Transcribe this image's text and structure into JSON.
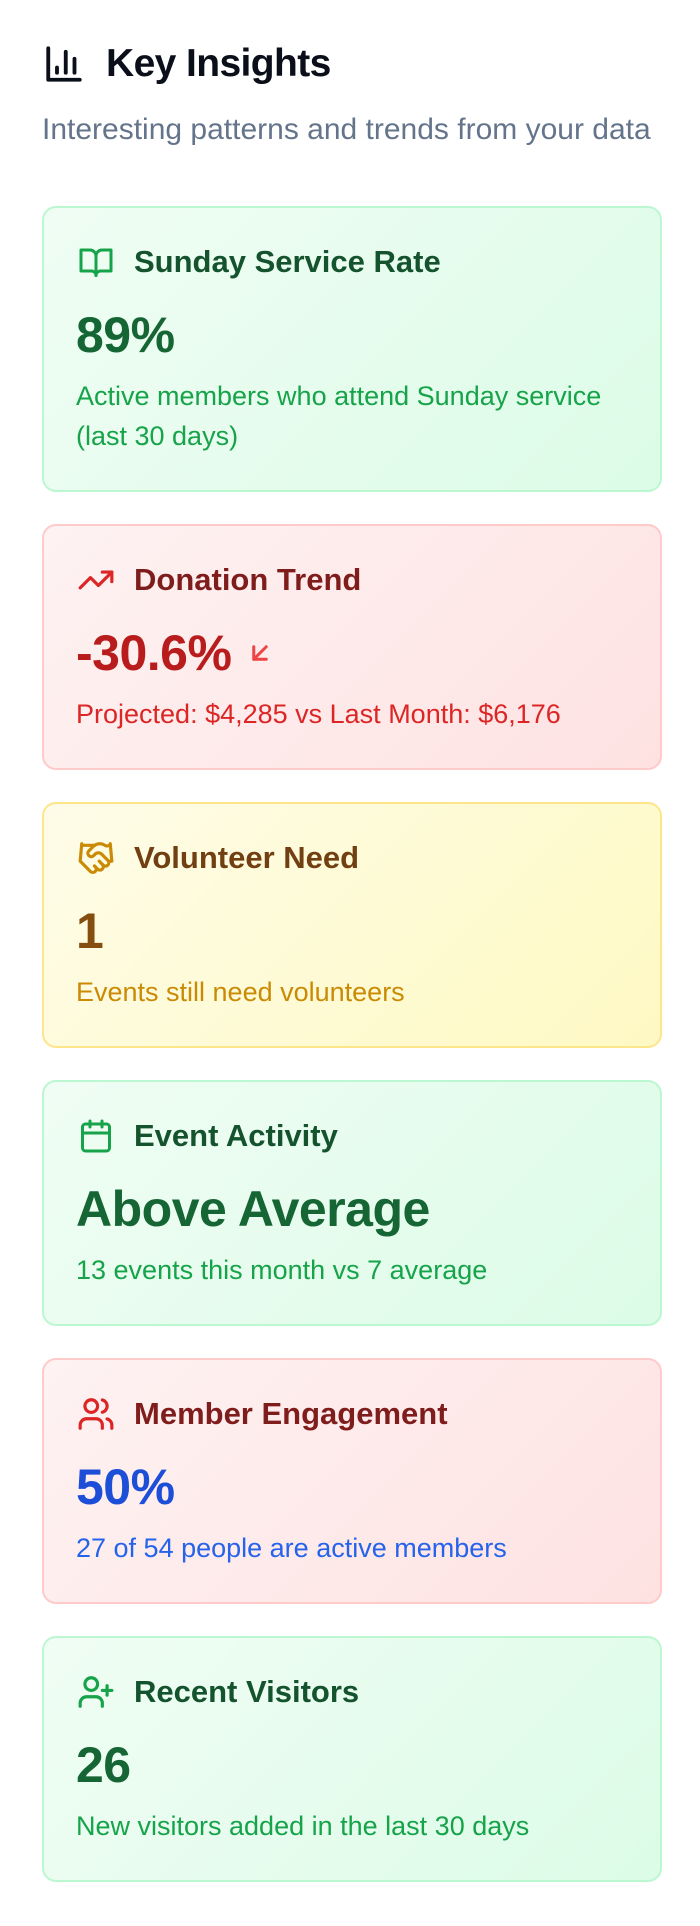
{
  "header": {
    "title": "Key Insights",
    "subtitle": "Interesting patterns and trends from your data",
    "icon": "bar-chart-icon"
  },
  "colors": {
    "green_bg": "#dcfce7",
    "red_bg": "#fee2e2",
    "yellow_bg": "#fef9c3",
    "blue_value": "#1d4ed8"
  },
  "cards": [
    {
      "title": "Sunday Service Rate",
      "icon": "book-open-icon",
      "value": "89%",
      "description": "Active members who attend Sunday service (last 30 days)",
      "theme": "green"
    },
    {
      "title": "Donation Trend",
      "icon": "trending-up-icon",
      "value": "-30.6%",
      "trend_icon": "arrow-down-left-icon",
      "description": "Projected: $4,285 vs Last Month: $6,176",
      "theme": "red"
    },
    {
      "title": "Volunteer Need",
      "icon": "handshake-icon",
      "value": "1",
      "description": "Events still need volunteers",
      "theme": "yellow"
    },
    {
      "title": "Event Activity",
      "icon": "calendar-icon",
      "value": "Above Average",
      "description": "13 events this month vs 7 average",
      "theme": "green"
    },
    {
      "title": "Member Engagement",
      "icon": "users-icon",
      "value": "50%",
      "description": "27 of 54 people are active members",
      "theme": "red"
    },
    {
      "title": "Recent Visitors",
      "icon": "user-plus-icon",
      "value": "26",
      "description": "New visitors added in the last 30 days",
      "theme": "green"
    }
  ]
}
